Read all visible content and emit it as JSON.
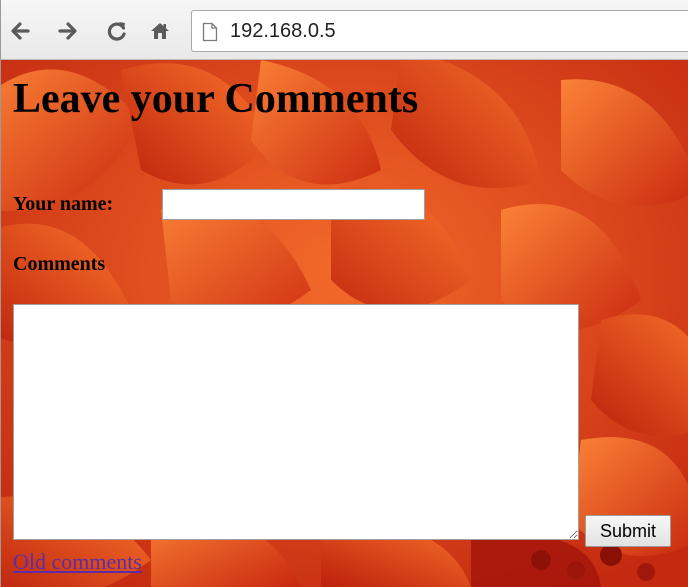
{
  "browser": {
    "url": "192.168.0.5",
    "icons": [
      "back-arrow-icon",
      "forward-arrow-icon",
      "reload-icon",
      "home-icon",
      "page-icon"
    ]
  },
  "page": {
    "heading": "Leave your Comments",
    "name_label": "Your name:",
    "name_value": "",
    "comments_label": "Comments",
    "comments_value": "",
    "submit_label": "Submit",
    "old_comments_link": "Old comments"
  },
  "colors": {
    "background_accent": "#e2401a",
    "link": "#5b2ea6"
  }
}
